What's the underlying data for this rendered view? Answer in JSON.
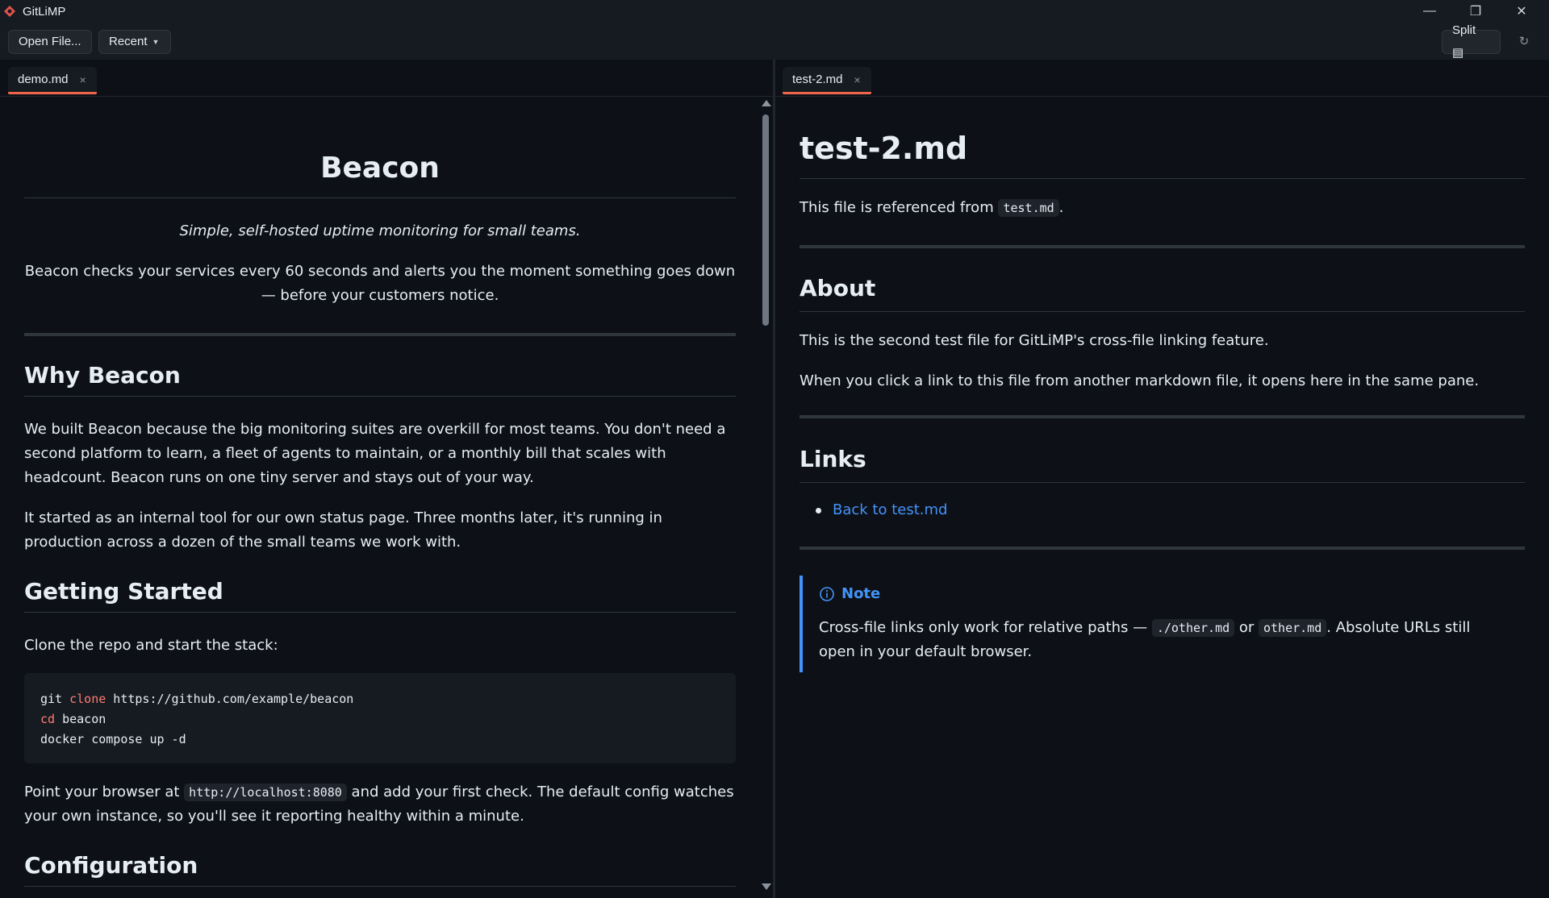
{
  "window": {
    "title": "GitLiMP",
    "minimize": "—",
    "maximize": "❐",
    "close": "✕",
    "accent": "#f0644a"
  },
  "toolbar": {
    "open_label": "Open File...",
    "recent_label": "Recent",
    "split_label": "Split ▤",
    "refresh_icon": "↻"
  },
  "left": {
    "tab_label": "demo.md",
    "tab_close": "×",
    "title": "Beacon",
    "tagline": "Simple, self-hosted uptime monitoring for small teams.",
    "intro": "Beacon checks your services every 60 seconds and alerts you the moment something goes down — before your customers notice.",
    "why_heading": "Why Beacon",
    "why_p1": "We built Beacon because the big monitoring suites are overkill for most teams. You don't need a second platform to learn, a fleet of agents to maintain, or a monthly bill that scales with headcount. Beacon runs on one tiny server and stays out of your way.",
    "why_p2": "It started as an internal tool for our own status page. Three months later, it's running in production across a dozen of the small teams we work with.",
    "gs_heading": "Getting Started",
    "clone_text": "Clone the repo and start the stack:",
    "code": {
      "l1_a": "git ",
      "l1_kw": "clone",
      "l1_b": " https://github.com/example/beacon",
      "l2_kw": "cd",
      "l2_b": " beacon",
      "l3": "docker compose up -d"
    },
    "point_a": "Point your browser at ",
    "point_code": "http://localhost:8080",
    "point_b": " and add your first check. The default config watches your own instance, so you'll see it reporting healthy within a minute.",
    "config_heading": "Configuration"
  },
  "right": {
    "tab_label": "test-2.md",
    "tab_close": "×",
    "title": "test-2.md",
    "ref_a": "This file is referenced from ",
    "ref_code": "test.md",
    "ref_b": ".",
    "about_heading": "About",
    "about_p1": "This is the second test file for GitLiMP's cross-file linking feature.",
    "about_p2": "When you click a link to this file from another markdown file, it opens here in the same pane.",
    "links_heading": "Links",
    "link_back": "Back to test.md",
    "note_title": "Note",
    "note_a": "Cross-file links only work for relative paths — ",
    "note_code1": "./other.md",
    "note_or": " or ",
    "note_code2": "other.md",
    "note_b": ". Absolute URLs still open in your default browser."
  }
}
